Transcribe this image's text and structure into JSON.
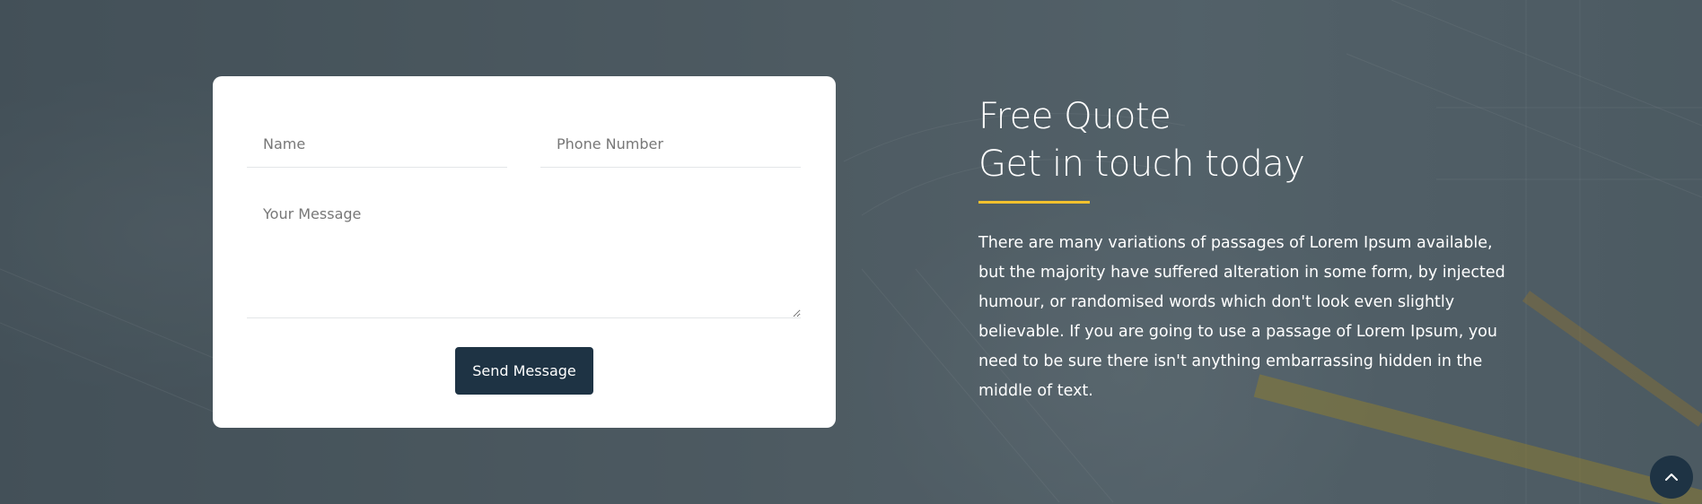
{
  "form": {
    "name_placeholder": "Name",
    "phone_placeholder": "Phone Number",
    "message_placeholder": "Your Message",
    "send_label": "Send Message"
  },
  "quote": {
    "title_line1": "Free Quote",
    "title_line2": "Get in touch today",
    "description": "There are many variations of passages of Lorem Ipsum available, but the majority have suffered alteration in some form, by injected humour, or randomised words which don't look even slightly believable. If you are going to use a passage of Lorem Ipsum, you need to be sure there isn't anything embarrassing hidden in the middle of text."
  },
  "colors": {
    "accent": "#f2c12e",
    "button": "#1e3344"
  },
  "icons": {
    "scroll_top": "chevron-up-icon"
  }
}
